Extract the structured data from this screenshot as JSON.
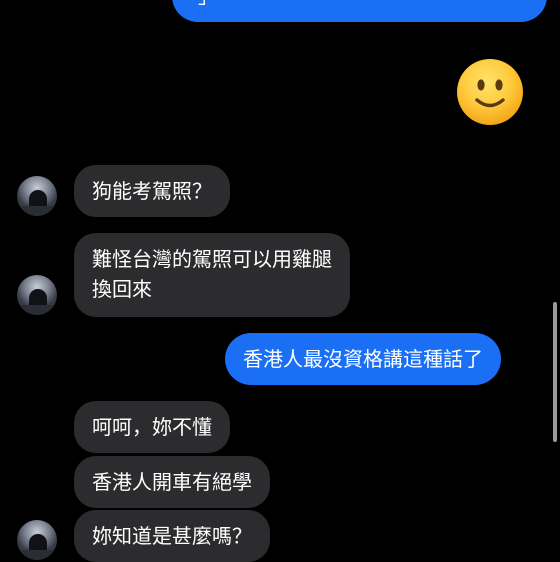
{
  "messages": {
    "sent_1": "」",
    "received_1": "狗能考駕照？",
    "received_2_line1": "難怪台灣的駕照可以用雞腿",
    "received_2_line2": "換回來",
    "sent_2": "香港人最沒資格講這種話了",
    "received_3": "呵呵，妳不懂",
    "received_4": "香港人開車有絕學",
    "received_5": "妳知道是甚麼嗎？"
  },
  "emoji_message": {
    "icon": "slightly-smiling-face-emoji"
  },
  "colors": {
    "background": "#000000",
    "incoming_bubble": "#2c2c2e",
    "outgoing_bubble": "#1a6ff5",
    "text": "#ffffff"
  }
}
